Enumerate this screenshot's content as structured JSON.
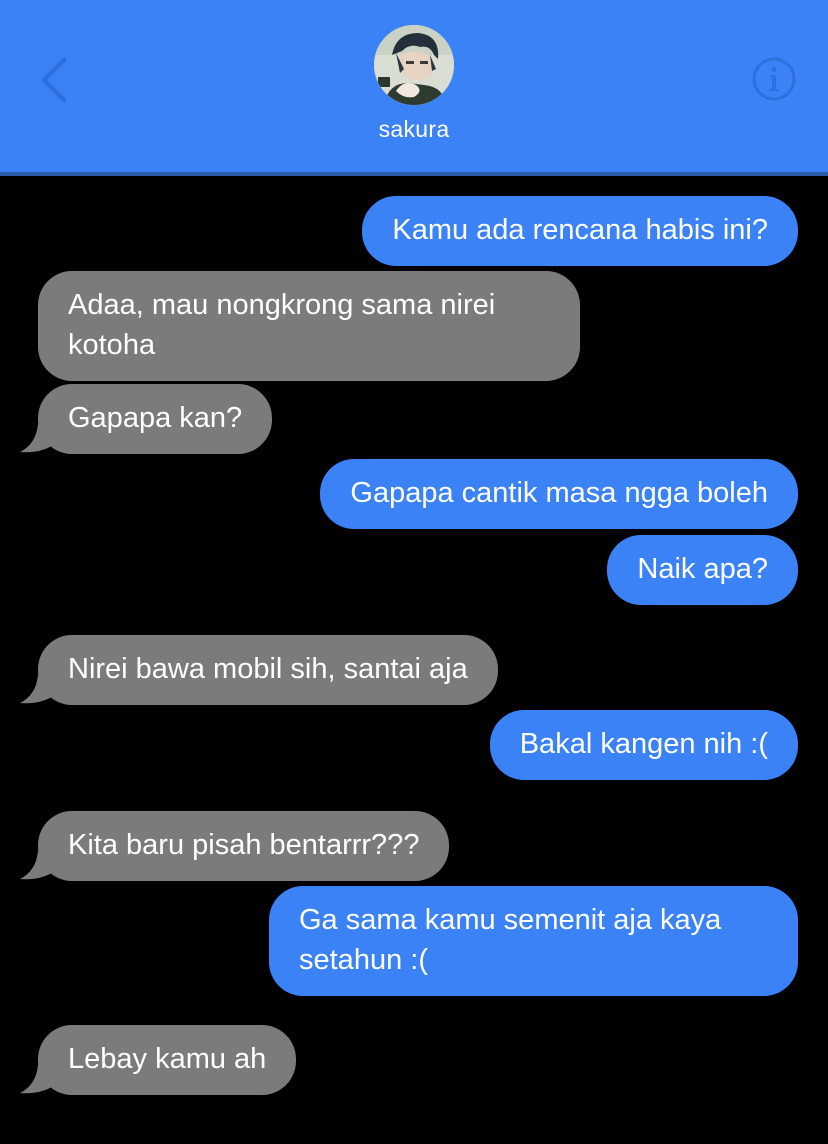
{
  "header": {
    "contact_name": "sakura",
    "back_icon": "chevron-left-icon",
    "info_icon": "info-icon",
    "avatar": "contact-avatar",
    "accent_color": "#3b82f6"
  },
  "messages": [
    {
      "direction": "outgoing",
      "text": "Kamu ada rencana habis ini?"
    },
    {
      "direction": "incoming",
      "text": "Adaa, mau nongkrong sama nirei kotoha"
    },
    {
      "direction": "incoming",
      "text": "Gapapa kan?"
    },
    {
      "direction": "outgoing",
      "text": "Gapapa cantik masa ngga boleh"
    },
    {
      "direction": "outgoing",
      "text": "Naik apa?"
    },
    {
      "direction": "incoming",
      "text": "Nirei bawa mobil sih, santai aja"
    },
    {
      "direction": "outgoing",
      "text": "Bakal kangen nih :("
    },
    {
      "direction": "incoming",
      "text": "Kita baru pisah bentarrr???"
    },
    {
      "direction": "outgoing",
      "text": "Ga sama kamu semenit aja kaya setahun :("
    },
    {
      "direction": "incoming",
      "text": "Lebay kamu ah"
    }
  ],
  "colors": {
    "outgoing_bubble": "#3b82f6",
    "incoming_bubble": "#7b7b7b",
    "background": "#000000"
  }
}
